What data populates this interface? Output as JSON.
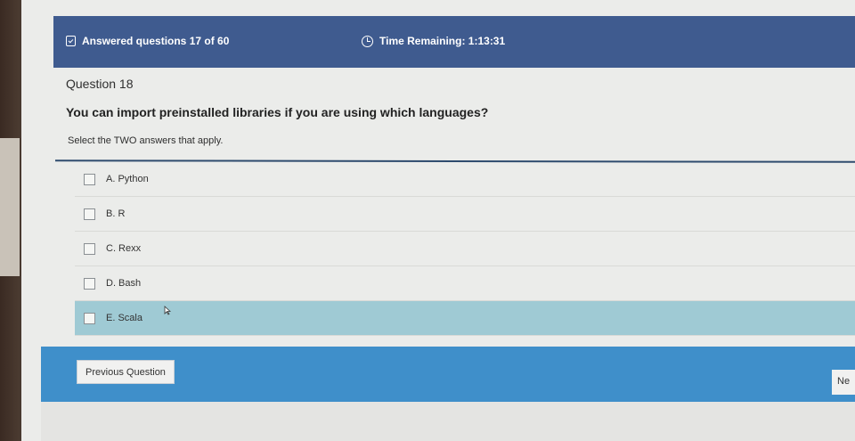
{
  "header": {
    "progress_text": "Answered questions 17 of 60",
    "timer_text": "Time Remaining: 1:13:31",
    "color": "#3f5b8f"
  },
  "question": {
    "number": "Question 18",
    "text": "You can import preinstalled libraries if you are using which languages?",
    "instruction": "Select the TWO answers that apply."
  },
  "answers": [
    {
      "label": "A.  Python"
    },
    {
      "label": "B.  R"
    },
    {
      "label": "C.  Rexx"
    },
    {
      "label": "D.  Bash"
    },
    {
      "label": "E.  Scala"
    }
  ],
  "footer": {
    "previous_label": "Previous Question",
    "next_label": "Ne",
    "color": "#3f8fca"
  },
  "icons": {
    "progress": "checklist-icon",
    "timer": "clock-icon",
    "pointer": "mouse-cursor-icon"
  }
}
